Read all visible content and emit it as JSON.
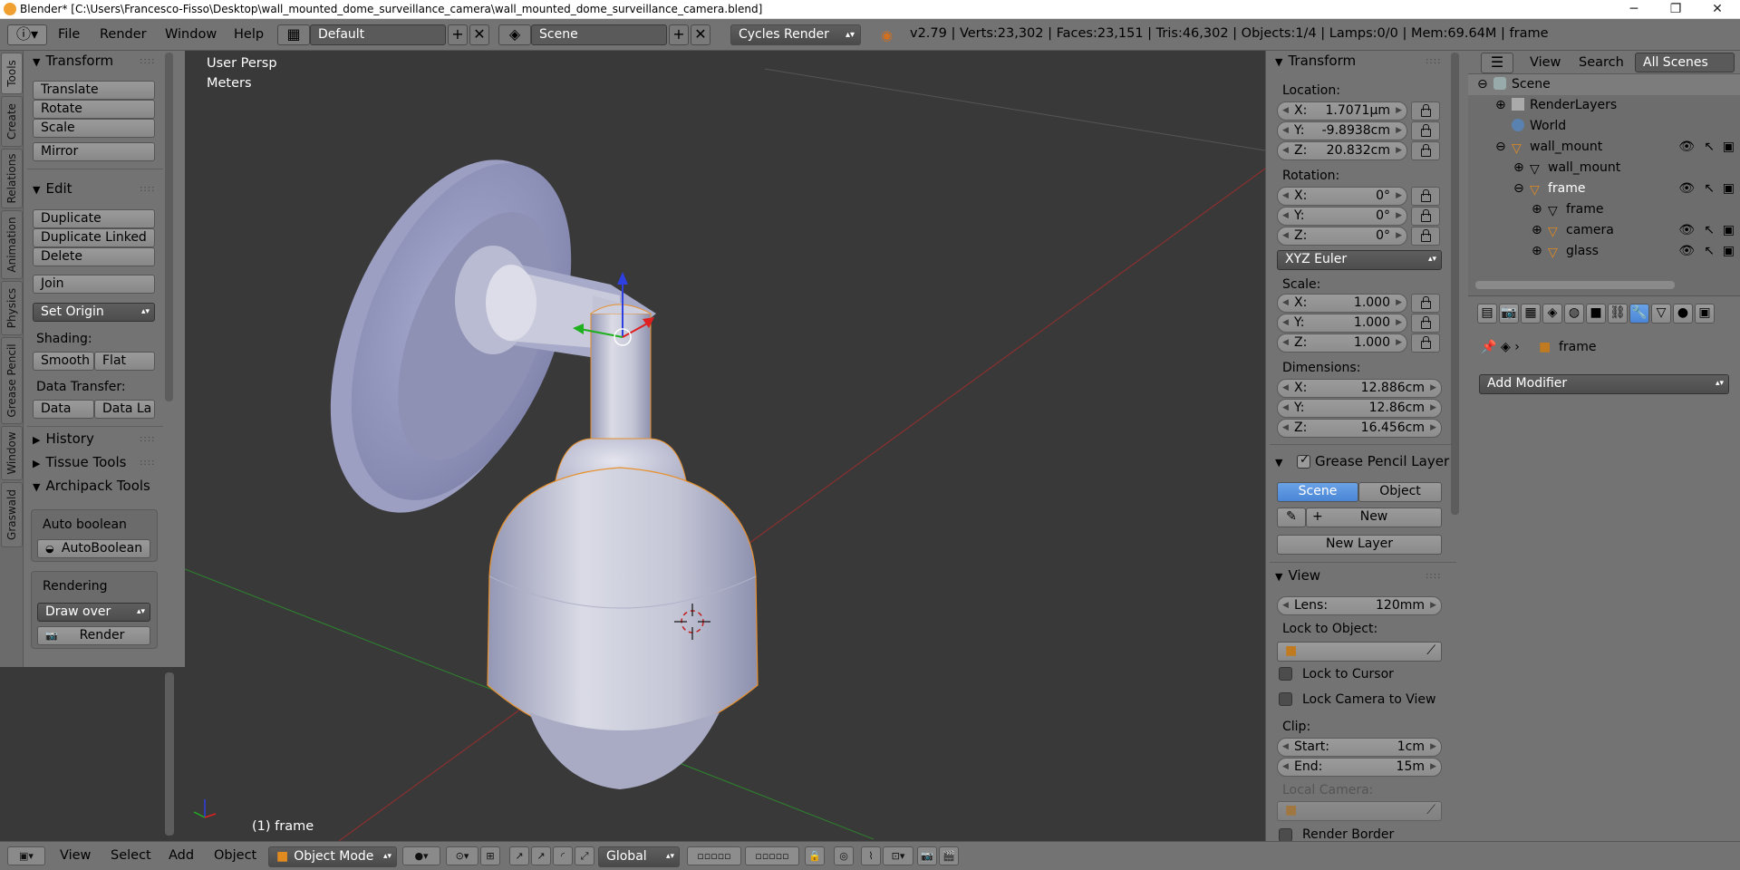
{
  "titlebar": {
    "title": "Blender* [C:\\Users\\Francesco-Fisso\\Desktop\\wall_mounted_dome_surveillance_camera\\wall_mounted_dome_surveillance_camera.blend]",
    "min": "─",
    "max": "❐",
    "close": "✕"
  },
  "header": {
    "menus": [
      "File",
      "Render",
      "Window",
      "Help"
    ],
    "layout": "Default",
    "scene": "Scene",
    "engine": "Cycles Render",
    "stats": "v2.79 | Verts:23,302 | Faces:23,151 | Tris:46,302 | Objects:1/4 | Lamps:0/0 | Mem:69.64M | frame"
  },
  "lefttabs": [
    "Tools",
    "Create",
    "Relations",
    "Animation",
    "Physics",
    "Grease Pencil",
    "Window",
    "Graswald"
  ],
  "tools": {
    "transform_title": "Transform",
    "translate": "Translate",
    "rotate": "Rotate",
    "scale": "Scale",
    "mirror": "Mirror",
    "edit_title": "Edit",
    "duplicate": "Duplicate",
    "duplicate_linked": "Duplicate Linked",
    "delete": "Delete",
    "join": "Join",
    "set_origin": "Set Origin",
    "shading_label": "Shading:",
    "smooth": "Smooth",
    "flat": "Flat",
    "data_transfer_label": "Data Transfer:",
    "data": "Data",
    "data_la": "Data La",
    "history": "History",
    "tissue": "Tissue Tools",
    "archipack": "Archipack Tools",
    "auto_boolean_label": "Auto boolean",
    "auto_boolean_btn": "AutoBoolean",
    "rendering_label": "Rendering",
    "draw_over": "Draw over",
    "render_btn": "Render"
  },
  "viewport": {
    "view_name": "User Persp",
    "units": "Meters",
    "object_label": "(1) frame"
  },
  "properties": {
    "transform_title": "Transform",
    "location_label": "Location:",
    "location": [
      {
        "k": "X:",
        "v": "1.7071µm"
      },
      {
        "k": "Y:",
        "v": "-9.8938cm"
      },
      {
        "k": "Z:",
        "v": "20.832cm"
      }
    ],
    "rotation_label": "Rotation:",
    "rotation": [
      {
        "k": "X:",
        "v": "0°"
      },
      {
        "k": "Y:",
        "v": "0°"
      },
      {
        "k": "Z:",
        "v": "0°"
      }
    ],
    "rotation_mode": "XYZ Euler",
    "scale_label": "Scale:",
    "scale": [
      {
        "k": "X:",
        "v": "1.000"
      },
      {
        "k": "Y:",
        "v": "1.000"
      },
      {
        "k": "Z:",
        "v": "1.000"
      }
    ],
    "dimensions_label": "Dimensions:",
    "dimensions": [
      {
        "k": "X:",
        "v": "12.886cm"
      },
      {
        "k": "Y:",
        "v": "12.86cm"
      },
      {
        "k": "Z:",
        "v": "16.456cm"
      }
    ],
    "gp_title": "Grease Pencil Layer",
    "gp_scene": "Scene",
    "gp_object": "Object",
    "gp_new": "New",
    "gp_new_layer": "New Layer",
    "view_title": "View",
    "lens_k": "Lens:",
    "lens_v": "120mm",
    "lock_to_object": "Lock to Object:",
    "lock_to_cursor": "Lock to Cursor",
    "lock_camera": "Lock Camera to View",
    "clip_label": "Clip:",
    "clip_start_k": "Start:",
    "clip_start_v": "1cm",
    "clip_end_k": "End:",
    "clip_end_v": "15m",
    "local_camera": "Local Camera:",
    "render_border": "Render Border"
  },
  "outliner": {
    "view": "View",
    "search": "Search",
    "all_scenes": "All Scenes",
    "rows": [
      "Scene",
      "RenderLayers",
      "World",
      "wall_mount",
      "wall_mount",
      "frame",
      "frame",
      "camera",
      "glass"
    ]
  },
  "modifiers": {
    "object_name": "frame",
    "add_modifier": "Add Modifier"
  },
  "bottom": {
    "menus": [
      "View",
      "Select",
      "Add",
      "Object"
    ],
    "mode": "Object Mode",
    "orientation": "Global"
  },
  "colors": {
    "selected_outline": "#f0a040",
    "accent_blue": "#5a96e0",
    "bg_dark": "#393939"
  }
}
